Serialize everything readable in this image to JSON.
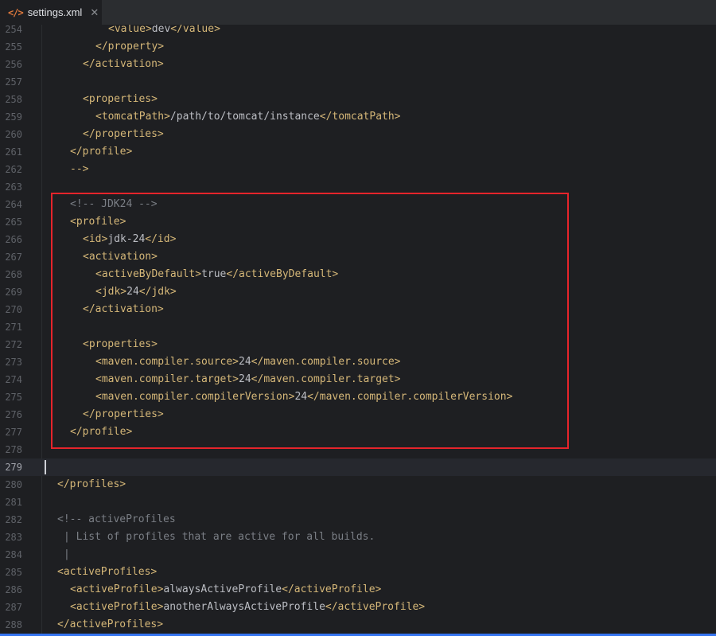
{
  "tab": {
    "icon": "code-xml-icon",
    "icon_glyph": "</>",
    "label": "settings.xml",
    "close": "✕"
  },
  "highlight_color": "#e5242b",
  "current_line": 279,
  "lines": [
    {
      "n": "254",
      "indent": 10,
      "parts": [
        [
          "tag",
          "<value>"
        ],
        [
          "val",
          "dev"
        ],
        [
          "tag",
          "</value>"
        ]
      ],
      "kind": "dim"
    },
    {
      "n": "255",
      "indent": 8,
      "parts": [
        [
          "tag",
          "</property>"
        ]
      ],
      "kind": "dim"
    },
    {
      "n": "256",
      "indent": 6,
      "parts": [
        [
          "tag",
          "</activation>"
        ]
      ],
      "kind": "dim"
    },
    {
      "n": "257",
      "indent": 0,
      "parts": [],
      "kind": "dim"
    },
    {
      "n": "258",
      "indent": 6,
      "parts": [
        [
          "tag",
          "<properties>"
        ]
      ],
      "kind": "dim"
    },
    {
      "n": "259",
      "indent": 8,
      "parts": [
        [
          "tag",
          "<tomcatPath>"
        ],
        [
          "val",
          "/path/to/tomcat/instance"
        ],
        [
          "tag",
          "</tomcatPath>"
        ]
      ],
      "kind": "dim"
    },
    {
      "n": "260",
      "indent": 6,
      "parts": [
        [
          "tag",
          "</properties>"
        ]
      ],
      "kind": "dim"
    },
    {
      "n": "261",
      "indent": 4,
      "parts": [
        [
          "tag",
          "</profile>"
        ]
      ],
      "kind": "dim"
    },
    {
      "n": "262",
      "indent": 4,
      "parts": [
        [
          "tag",
          "-->"
        ]
      ],
      "kind": "dim"
    },
    {
      "n": "263",
      "indent": 0,
      "parts": [],
      "kind": "normal"
    },
    {
      "n": "264",
      "indent": 4,
      "parts": [
        [
          "cmt",
          "<!-- JDK24 -->"
        ]
      ],
      "kind": "normal"
    },
    {
      "n": "265",
      "indent": 4,
      "parts": [
        [
          "tag",
          "<profile>"
        ]
      ],
      "kind": "normal"
    },
    {
      "n": "266",
      "indent": 6,
      "parts": [
        [
          "tag",
          "<id>"
        ],
        [
          "val",
          "jdk-24"
        ],
        [
          "tag",
          "</id>"
        ]
      ],
      "kind": "normal"
    },
    {
      "n": "267",
      "indent": 6,
      "parts": [
        [
          "tag",
          "<activation>"
        ]
      ],
      "kind": "normal"
    },
    {
      "n": "268",
      "indent": 8,
      "parts": [
        [
          "tag",
          "<activeByDefault>"
        ],
        [
          "val",
          "true"
        ],
        [
          "tag",
          "</activeByDefault>"
        ]
      ],
      "kind": "normal"
    },
    {
      "n": "269",
      "indent": 8,
      "parts": [
        [
          "tag",
          "<jdk>"
        ],
        [
          "val",
          "24"
        ],
        [
          "tag",
          "</jdk>"
        ]
      ],
      "kind": "normal"
    },
    {
      "n": "270",
      "indent": 6,
      "parts": [
        [
          "tag",
          "</activation>"
        ]
      ],
      "kind": "normal"
    },
    {
      "n": "271",
      "indent": 0,
      "parts": [],
      "kind": "normal"
    },
    {
      "n": "272",
      "indent": 6,
      "parts": [
        [
          "tag",
          "<properties>"
        ]
      ],
      "kind": "normal"
    },
    {
      "n": "273",
      "indent": 8,
      "parts": [
        [
          "tag",
          "<maven.compiler.source>"
        ],
        [
          "val",
          "24"
        ],
        [
          "tag",
          "</maven.compiler.source>"
        ]
      ],
      "kind": "normal"
    },
    {
      "n": "274",
      "indent": 8,
      "parts": [
        [
          "tag",
          "<maven.compiler.target>"
        ],
        [
          "val",
          "24"
        ],
        [
          "tag",
          "</maven.compiler.target>"
        ]
      ],
      "kind": "normal"
    },
    {
      "n": "275",
      "indent": 8,
      "parts": [
        [
          "tag",
          "<maven.compiler.compilerVersion>"
        ],
        [
          "val",
          "24"
        ],
        [
          "tag",
          "</maven.compiler.compilerVersion>"
        ]
      ],
      "kind": "normal"
    },
    {
      "n": "276",
      "indent": 6,
      "parts": [
        [
          "tag",
          "</properties>"
        ]
      ],
      "kind": "normal"
    },
    {
      "n": "277",
      "indent": 4,
      "parts": [
        [
          "tag",
          "</profile>"
        ]
      ],
      "kind": "normal"
    },
    {
      "n": "278",
      "indent": 0,
      "parts": [],
      "kind": "normal"
    },
    {
      "n": "279",
      "indent": 0,
      "parts": [],
      "kind": "normal"
    },
    {
      "n": "280",
      "indent": 2,
      "parts": [
        [
          "tag",
          "</profiles>"
        ]
      ],
      "kind": "normal"
    },
    {
      "n": "281",
      "indent": 0,
      "parts": [],
      "kind": "normal"
    },
    {
      "n": "282",
      "indent": 2,
      "parts": [
        [
          "cmt",
          "<!-- activeProfiles"
        ]
      ],
      "kind": "normal"
    },
    {
      "n": "283",
      "indent": 3,
      "parts": [
        [
          "cmt",
          "| List of profiles that are active for all builds."
        ]
      ],
      "kind": "normal"
    },
    {
      "n": "284",
      "indent": 3,
      "parts": [
        [
          "cmt",
          "|"
        ]
      ],
      "kind": "normal"
    },
    {
      "n": "285",
      "indent": 2,
      "parts": [
        [
          "tag",
          "<activeProfiles>"
        ]
      ],
      "kind": "dim"
    },
    {
      "n": "286",
      "indent": 4,
      "parts": [
        [
          "tag",
          "<activeProfile>"
        ],
        [
          "val",
          "alwaysActiveProfile"
        ],
        [
          "tag",
          "</activeProfile>"
        ]
      ],
      "kind": "dim"
    },
    {
      "n": "287",
      "indent": 4,
      "parts": [
        [
          "tag",
          "<activeProfile>"
        ],
        [
          "val",
          "anotherAlwaysActiveProfile"
        ],
        [
          "tag",
          "</activeProfile>"
        ]
      ],
      "kind": "dim"
    },
    {
      "n": "288",
      "indent": 2,
      "parts": [
        [
          "tag",
          "</activeProfiles>"
        ]
      ],
      "kind": "dim"
    }
  ]
}
